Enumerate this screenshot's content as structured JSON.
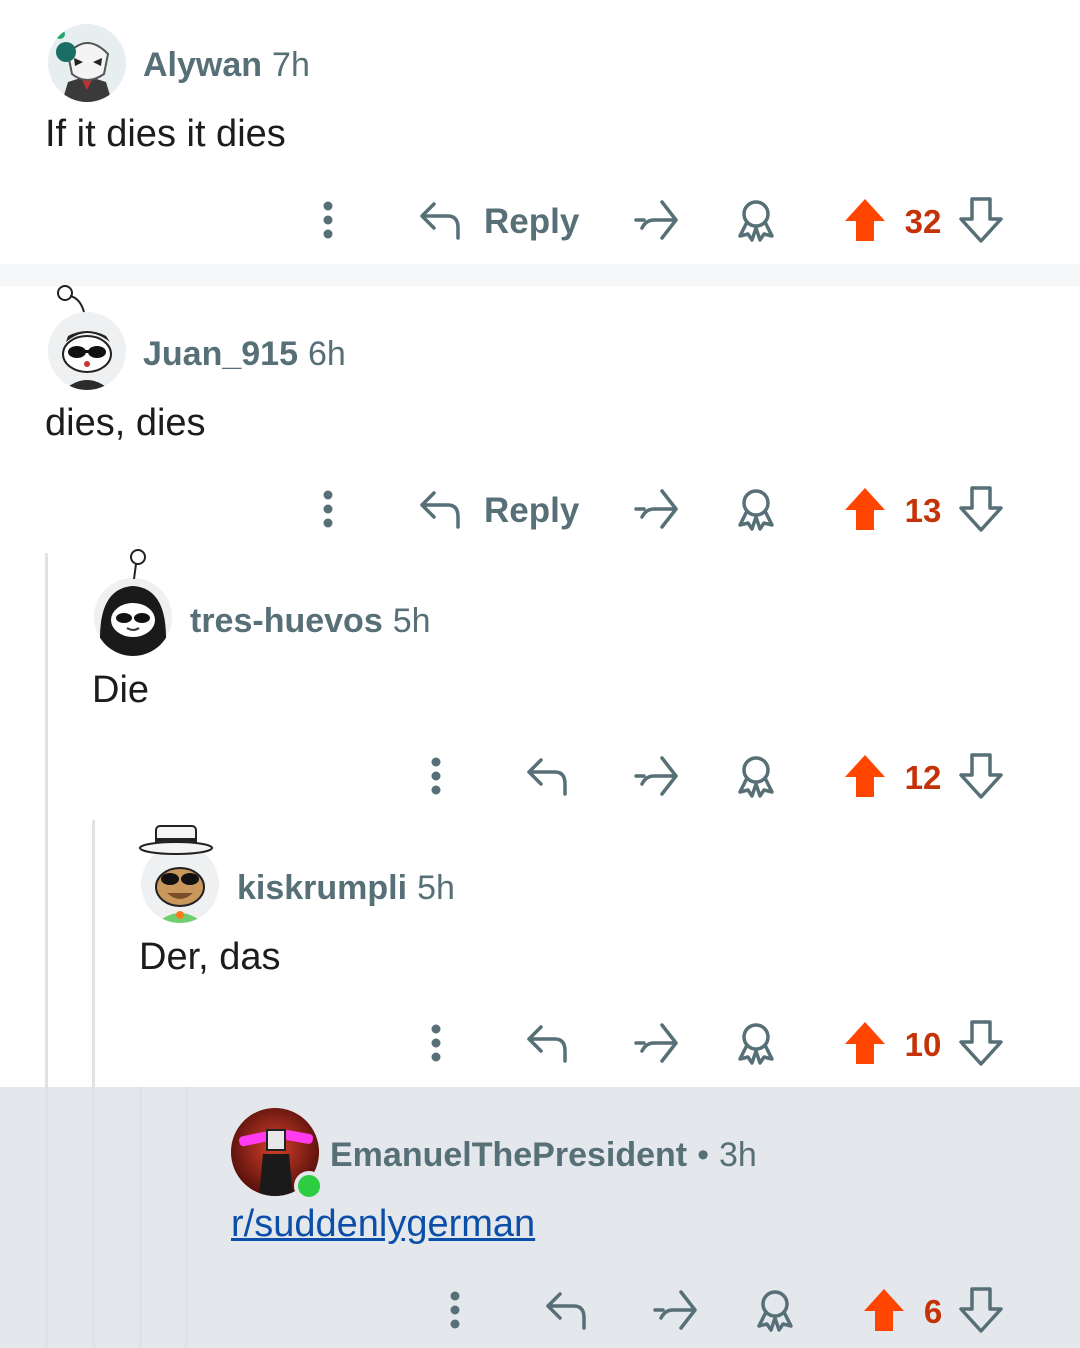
{
  "colors": {
    "upvote": "#ff4500",
    "score": "#c33307",
    "meta": "#576f76",
    "link": "#0b4fa8",
    "highlight": "#e4e8ec",
    "online": "#2ecc40"
  },
  "comments": [
    {
      "username": "Alywan",
      "time": "7h",
      "body": "If it dies it dies",
      "score": "32",
      "reply_label": "Reply"
    },
    {
      "username": "Juan_915",
      "time": "6h",
      "body": "dies, dies",
      "score": "13",
      "reply_label": "Reply"
    },
    {
      "username": "tres-huevos",
      "time": "5h",
      "body": "Die",
      "score": "12"
    },
    {
      "username": "kiskrumpli",
      "time": "5h",
      "body": "Der, das",
      "score": "10"
    },
    {
      "username": "EmanuelThePresident",
      "separator": "•",
      "time": "3h",
      "body": "r/suddenlygerman",
      "score": "6",
      "online": true
    }
  ],
  "icons": [
    "more-vertical-icon",
    "reply-arrow-icon",
    "share-icon",
    "award-icon",
    "upvote-arrow-icon",
    "downvote-arrow-icon"
  ]
}
